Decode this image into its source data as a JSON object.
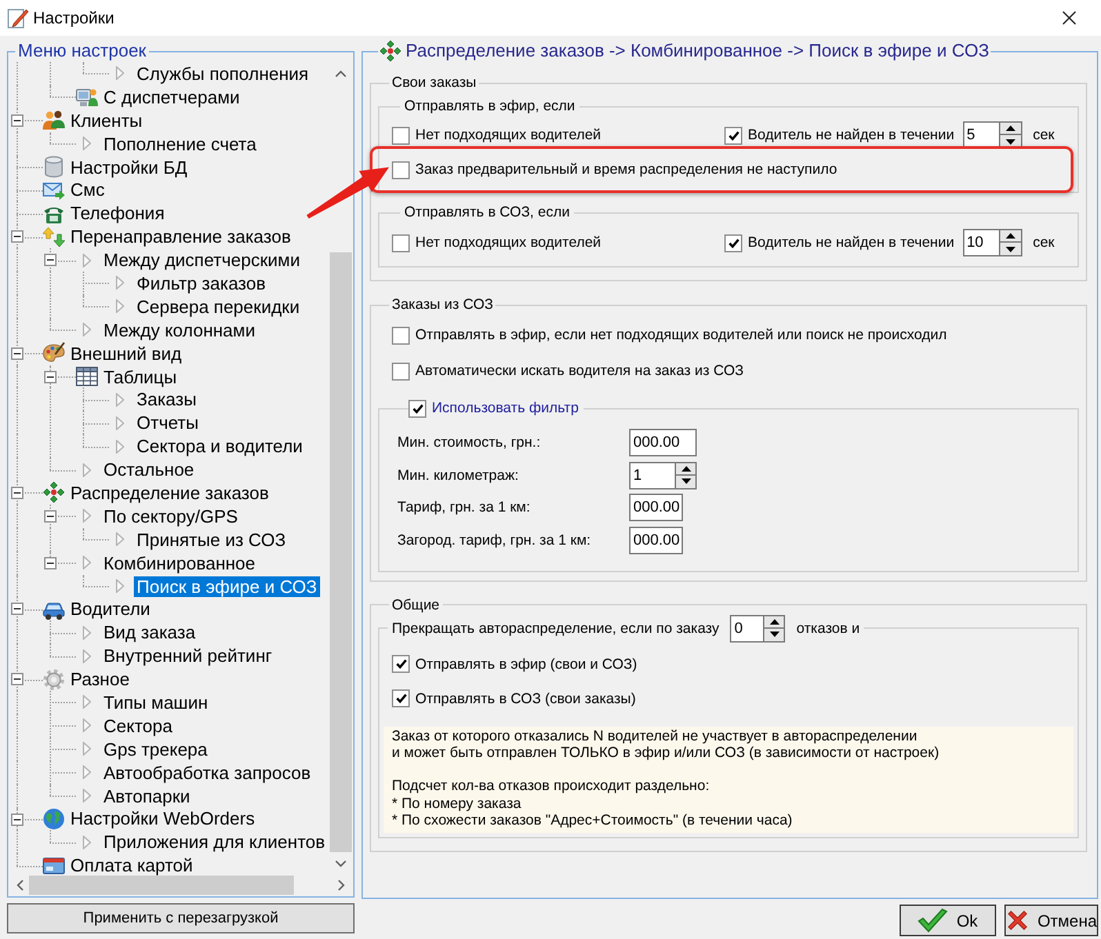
{
  "window": {
    "title": "Настройки"
  },
  "menu": {
    "title": "Меню настроек",
    "items": [
      {
        "expanded": true,
        "children": [
          {
            "expanded": true,
            "children": [
              {
                "label": "Службы пополнения",
                "kind": "page",
                "selected": false
              }
            ]
          },
          {
            "label": "С диспетчерами",
            "kind": "category",
            "selected": false
          }
        ]
      },
      {
        "label": "Клиенты",
        "kind": "category",
        "selected": false,
        "expanded": true,
        "children": [
          {
            "label": "Пополнение счета",
            "kind": "page",
            "selected": false
          }
        ]
      },
      {
        "label": "Настройки БД",
        "kind": "category",
        "selected": false
      },
      {
        "label": "Смс",
        "kind": "category",
        "selected": false
      },
      {
        "label": "Телефония",
        "kind": "category",
        "selected": false
      },
      {
        "label": "Перенаправление заказов",
        "kind": "category",
        "selected": false,
        "expanded": true,
        "children": [
          {
            "label": "Между диспетчерскими",
            "kind": "page",
            "selected": false,
            "expanded": true,
            "children": [
              {
                "label": "Фильтр заказов",
                "kind": "page",
                "selected": false
              },
              {
                "label": "Сервера перекидки",
                "kind": "page",
                "selected": false
              }
            ]
          },
          {
            "label": "Между колоннами",
            "kind": "page",
            "selected": false
          }
        ]
      },
      {
        "label": "Внешний вид",
        "kind": "category",
        "selected": false,
        "expanded": true,
        "children": [
          {
            "label": "Таблицы",
            "kind": "category",
            "selected": false,
            "expanded": true,
            "children": [
              {
                "label": "Заказы",
                "kind": "page",
                "selected": false
              },
              {
                "label": "Отчеты",
                "kind": "page",
                "selected": false
              },
              {
                "label": "Сектора и водители",
                "kind": "page",
                "selected": false
              }
            ]
          },
          {
            "label": "Остальное",
            "kind": "page",
            "selected": false
          }
        ]
      },
      {
        "label": "Распределение заказов",
        "kind": "category",
        "selected": false,
        "expanded": true,
        "children": [
          {
            "label": "По сектору/GPS",
            "kind": "page",
            "selected": false,
            "expanded": true,
            "children": [
              {
                "label": "Принятые из СОЗ",
                "kind": "page",
                "selected": false
              }
            ]
          },
          {
            "label": "Комбинированное",
            "kind": "page",
            "selected": false,
            "expanded": true,
            "children": [
              {
                "label": "Поиск в эфире и СОЗ",
                "kind": "page",
                "selected": true
              }
            ]
          }
        ]
      },
      {
        "label": "Водители",
        "kind": "category",
        "selected": false,
        "expanded": true,
        "children": [
          {
            "label": "Вид заказа",
            "kind": "page",
            "selected": false
          },
          {
            "label": "Внутренний рейтинг",
            "kind": "page",
            "selected": false
          }
        ]
      },
      {
        "label": "Разное",
        "kind": "category",
        "selected": false,
        "expanded": true,
        "children": [
          {
            "label": "Типы машин",
            "kind": "page",
            "selected": false
          },
          {
            "label": "Сектора",
            "kind": "page",
            "selected": false
          },
          {
            "label": "Gps трекера",
            "kind": "page",
            "selected": false
          },
          {
            "label": "Автообработка запросов",
            "kind": "page",
            "selected": false
          },
          {
            "label": "Автопарки",
            "kind": "page",
            "selected": false
          }
        ]
      },
      {
        "label": "Настройки WebOrders",
        "kind": "category",
        "selected": false,
        "expanded": true,
        "children": [
          {
            "label": "Приложения для клиентов",
            "kind": "page",
            "selected": false
          }
        ]
      },
      {
        "label": "Оплата картой",
        "kind": "category",
        "selected": false
      }
    ]
  },
  "apply_button": {
    "label": "Применить с перезагрузкой"
  },
  "page": {
    "breadcrumb": "Распределение заказов -> Комбинированное -> Поиск в эфире и СОЗ",
    "own_orders": {
      "title": "Свои заказы",
      "sections": [
        {
          "title": "Отправлять в эфир, если",
          "rows": [
            [
              {
                "kind": "checkbox",
                "label": "Нет подходящих водителей",
                "checked": false
              },
              {
                "kind": "timeout",
                "label": "Водитель не найден в течении",
                "checked": true,
                "value": "5",
                "unit": "сек"
              }
            ],
            [
              {
                "kind": "checkbox",
                "label": "Заказ предварительный и время распределения не наступило",
                "checked": false
              }
            ]
          ]
        },
        {
          "title": "Отправлять в СОЗ, если",
          "rows": [
            [
              {
                "kind": "checkbox",
                "label": "Нет подходящих водителей",
                "checked": false
              },
              {
                "kind": "timeout",
                "label": "Водитель не найден в течении",
                "checked": true,
                "value": "10",
                "unit": "сек"
              }
            ]
          ]
        }
      ]
    },
    "soz_orders": {
      "title": "Заказы из СОЗ",
      "options": [
        {
          "label": "Отправлять в эфир, если нет подходящих водителей или поиск не происходил",
          "checked": false
        },
        {
          "label": "Автоматически искать водителя на заказ из СОЗ",
          "checked": false
        }
      ],
      "filter": {
        "label": "Использовать фильтр",
        "checked": true,
        "fields": [
          {
            "kind": "text",
            "label": "Мин. стоимость, грн.:",
            "value": "000.00"
          },
          {
            "kind": "spin",
            "label": "Мин. километраж:",
            "value": "1"
          },
          {
            "kind": "text",
            "label": "Тариф, грн. за 1 км:",
            "value": "000.00"
          },
          {
            "kind": "text",
            "label": "Загород. тариф, грн. за 1 км:",
            "value": "000.00"
          }
        ]
      }
    },
    "general": {
      "title": "Общие",
      "limit": {
        "prefix": "Прекращать автораспределение, если по заказу",
        "value": "0",
        "suffix": "отказов и"
      },
      "options": [
        {
          "label": "Отправлять в эфир (свои и СОЗ)",
          "checked": true
        },
        {
          "label": "Отправлять в СОЗ (свои заказы)",
          "checked": true
        }
      ],
      "note": [
        [
          "Заказ от которого отказались N водителей не участвует в автораспределении",
          "и может быть отправлен ТОЛЬКО в эфир и/или СОЗ (в зависимости от настроек)"
        ],
        [
          "Подсчет кол-ва отказов происходит раздельно:",
          "* По номеру заказа",
          "* По схожести заказов \"Адрес+Стоимость\" (в течении часа)"
        ]
      ]
    }
  },
  "buttons": [
    {
      "label": "Ok",
      "kind": "ok"
    },
    {
      "label": "Отмена",
      "kind": "cancel"
    }
  ]
}
